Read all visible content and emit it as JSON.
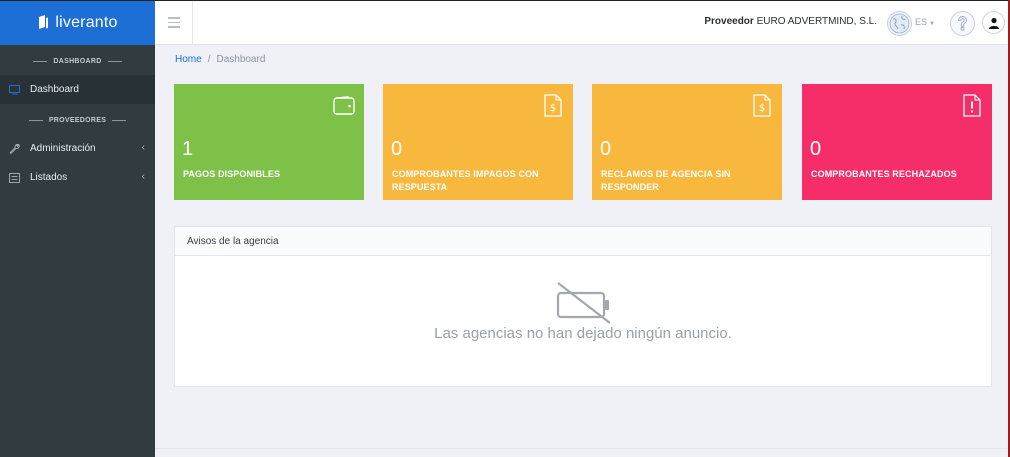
{
  "brand": {
    "name": "liveranto",
    "color": "#1d6fd6"
  },
  "sidebar": {
    "sections": [
      {
        "title": "DASHBOARD"
      },
      {
        "title": "PROVEEDORES"
      }
    ],
    "items": [
      {
        "label": "Dashboard",
        "icon": "monitor-icon",
        "active": true
      },
      {
        "label": "Administración",
        "icon": "wrench-icon",
        "chevron": "‹"
      },
      {
        "label": "Listados",
        "icon": "list-icon",
        "chevron": "‹"
      }
    ]
  },
  "header": {
    "supplier_label": "Proveedor",
    "supplier_name": "EURO ADVERTMIND, S.L.",
    "language": "ES"
  },
  "breadcrumb": {
    "home": "Home",
    "separator": "/",
    "current": "Dashboard"
  },
  "cards": [
    {
      "value": "1",
      "label": "PAGOS DISPONIBLES",
      "icon": "wallet-icon",
      "color": "#7dc148"
    },
    {
      "value": "0",
      "label": "COMPROBANTES IMPAGOS CON RESPUESTA",
      "icon": "invoice-dollar-icon",
      "color": "#f8b83e"
    },
    {
      "value": "0",
      "label": "RECLAMOS DE AGENCIA SIN RESPONDER",
      "icon": "invoice-dollar-icon",
      "color": "#f8b83e"
    },
    {
      "value": "0",
      "label": "COMPROBANTES RECHAZADOS",
      "icon": "file-alert-icon",
      "color": "#f52e6a"
    }
  ],
  "notices": {
    "title": "Avisos de la agencia",
    "empty_message": "Las agencias no han dejado ningún anuncio.",
    "empty_icon": "battery-slash-icon"
  }
}
